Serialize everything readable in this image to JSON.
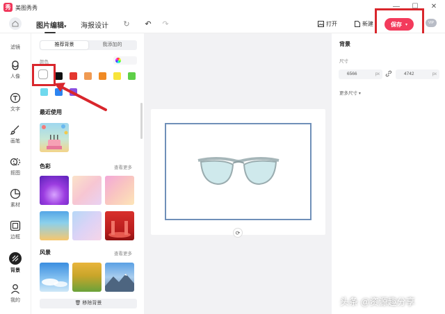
{
  "window": {
    "title": "美图秀秀",
    "logo_text": "秀"
  },
  "toolbar": {
    "tabs": [
      {
        "label": "图片编辑",
        "active": true
      },
      {
        "label": "海报设计",
        "active": false
      }
    ],
    "open_label": "打开",
    "new_label": "新建",
    "save_label": "保存",
    "vip_label": "VIP"
  },
  "rail": {
    "items": [
      {
        "label": "滤镜",
        "icon": "filter-icon"
      },
      {
        "label": "人像",
        "icon": "portrait-icon"
      },
      {
        "label": "文字",
        "icon": "text-icon"
      },
      {
        "label": "画笔",
        "icon": "brush-icon"
      },
      {
        "label": "抠图",
        "icon": "cutout-icon"
      },
      {
        "label": "素材",
        "icon": "sticker-icon"
      },
      {
        "label": "边框",
        "icon": "frame-icon"
      },
      {
        "label": "背景",
        "icon": "background-icon",
        "active": true
      },
      {
        "label": "我的",
        "icon": "user-icon"
      }
    ]
  },
  "panel": {
    "seg_recommended": "推荐背景",
    "seg_mine": "我添加的",
    "color_label": "颜色",
    "swatches": [
      "#ffffff",
      "#111111",
      "#e4372f",
      "#f09a52",
      "#f08a24",
      "#f7e43a",
      "#5ecf48",
      "#6fd9ee",
      "#2d84f0",
      "#8a4fe0"
    ],
    "recent_title": "最近使用",
    "color_title": "色彩",
    "color_more": "查看更多",
    "scenery_title": "风景",
    "scenery_more": "查看更多",
    "remove_label": "移除背景"
  },
  "right": {
    "title": "背景",
    "size_label": "尺寸",
    "width": "6566",
    "height": "4742",
    "unit": "px",
    "more_size": "更多尺寸"
  },
  "watermark": "头条 @资源趣分享",
  "colors": {
    "accent": "#f33b5c",
    "highlight": "#d9262c"
  }
}
